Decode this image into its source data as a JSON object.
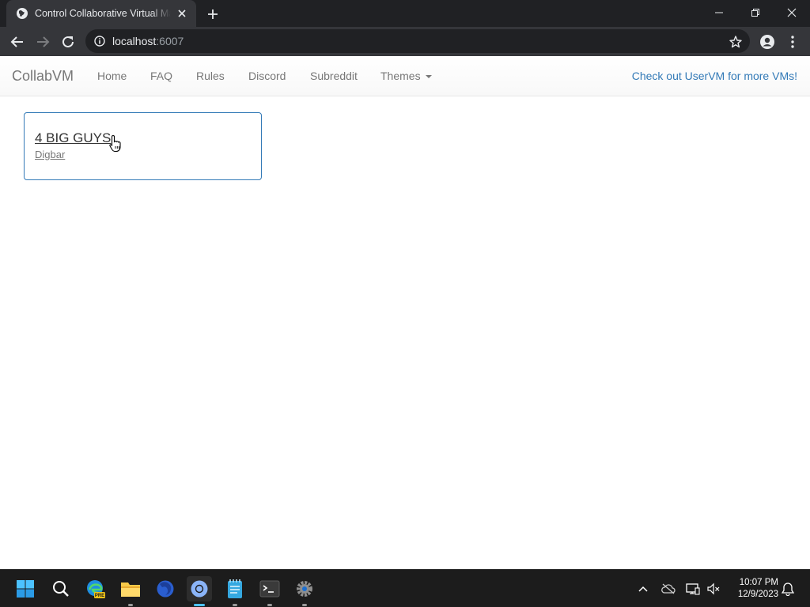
{
  "browser": {
    "tab_title": "Control Collaborative Virtual Machines",
    "url_host": "localhost",
    "url_port": ":6007"
  },
  "navbar": {
    "brand": "CollabVM",
    "links": [
      "Home",
      "FAQ",
      "Rules",
      "Discord",
      "Subreddit"
    ],
    "themes_label": "Themes",
    "promo": "Check out UserVM for more VMs!"
  },
  "vm_list": [
    {
      "title": "4 BIG GUYS",
      "subtitle": "Digbar"
    }
  ],
  "taskbar": {
    "apps": [
      "start-icon",
      "search-icon",
      "edge-preview-icon",
      "file-explorer-icon",
      "firefox-icon",
      "chrome-icon",
      "notepad-icon",
      "terminal-icon",
      "settings-icon"
    ],
    "time": "10:07 PM",
    "date": "12/9/2023"
  },
  "colors": {
    "link_blue": "#337ab7",
    "chrome_dark": "#35363a",
    "taskbar": "#1c1c1c",
    "active_indicator": "#4cc2ff"
  }
}
